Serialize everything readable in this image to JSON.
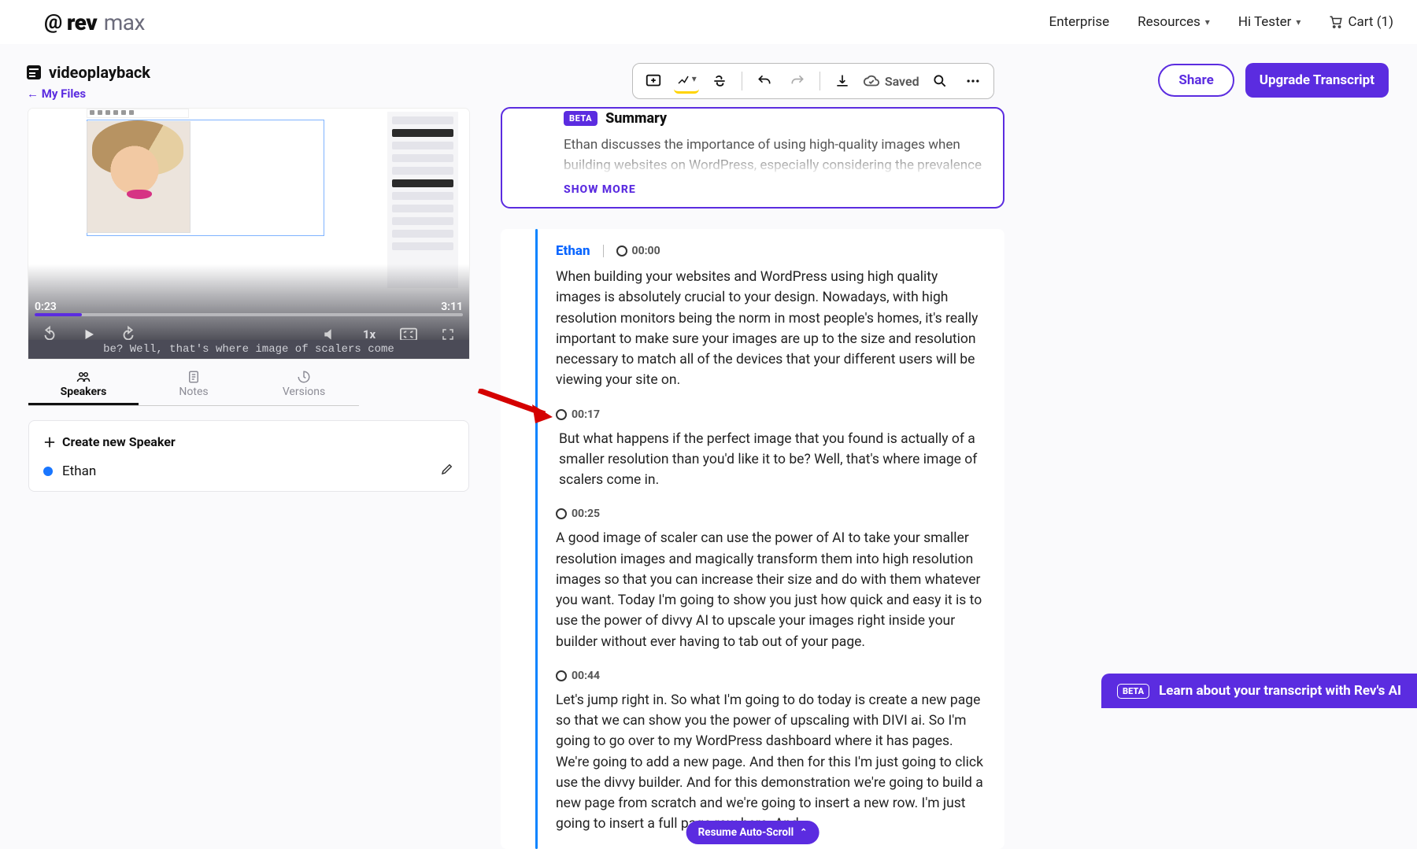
{
  "nav": {
    "brand_prefix": "rev",
    "brand_suffix": "max",
    "enterprise": "Enterprise",
    "resources": "Resources",
    "greeting": "Hi Tester",
    "cart": "Cart (1)"
  },
  "file": {
    "title": "videoplayback",
    "back": "← My Files"
  },
  "toolbar": {
    "saved": "Saved"
  },
  "actions": {
    "share": "Share",
    "upgrade": "Upgrade Transcript"
  },
  "player": {
    "current": "0:23",
    "duration": "3:11",
    "rate": "1x",
    "caption": "be? Well, that's where image of scalers come"
  },
  "tabs": {
    "speakers": "Speakers",
    "notes": "Notes",
    "versions": "Versions"
  },
  "speakers": {
    "create": "Create new Speaker",
    "list": [
      "Ethan"
    ]
  },
  "summary": {
    "badge": "BETA",
    "title": "Summary",
    "text": "Ethan discusses the importance of using high-quality images when building websites on WordPress, especially considering the prevalence of high-",
    "show_more": "SHOW MORE"
  },
  "transcript": {
    "speaker": "Ethan",
    "blocks": [
      {
        "ts": "00:00",
        "text": "When building your websites and WordPress using high quality images is absolutely crucial to your design. Nowadays, with high resolution monitors being the norm in most people's homes, it's really important to make sure your images are up to the size and resolution necessary to match all of the devices that your different users will be viewing your site on."
      },
      {
        "ts": "00:17",
        "text": " But what happens if the perfect image that you found is actually of a smaller resolution than you'd like it to be? Well, that's where image of scalers come in."
      },
      {
        "ts": "00:25",
        "text": "A good image of scaler can use the power of AI to take your smaller resolution images and magically transform them into high resolution images so that you can increase their size and do with them whatever you want. Today I'm going to show you just how quick and easy it is to use the power of divvy AI to upscale your images right inside your builder without ever having to tab out of your page."
      },
      {
        "ts": "00:44",
        "text": "Let's jump right in. So what I'm going to do today is create a new page so that we can show you the power of upscaling with DIVI ai. So I'm going to go over to my WordPress dashboard where it has pages. We're going to add a new page. And then for this I'm just going to click use the divvy builder. And for this demonstration we're going to build a new page from scratch and we're going to insert a new row. I'm just going to insert a full page row here. And"
      }
    ]
  },
  "resume": "Resume Auto-Scroll",
  "ai_banner": {
    "badge": "BETA",
    "text": "Learn about your transcript with Rev's AI"
  }
}
